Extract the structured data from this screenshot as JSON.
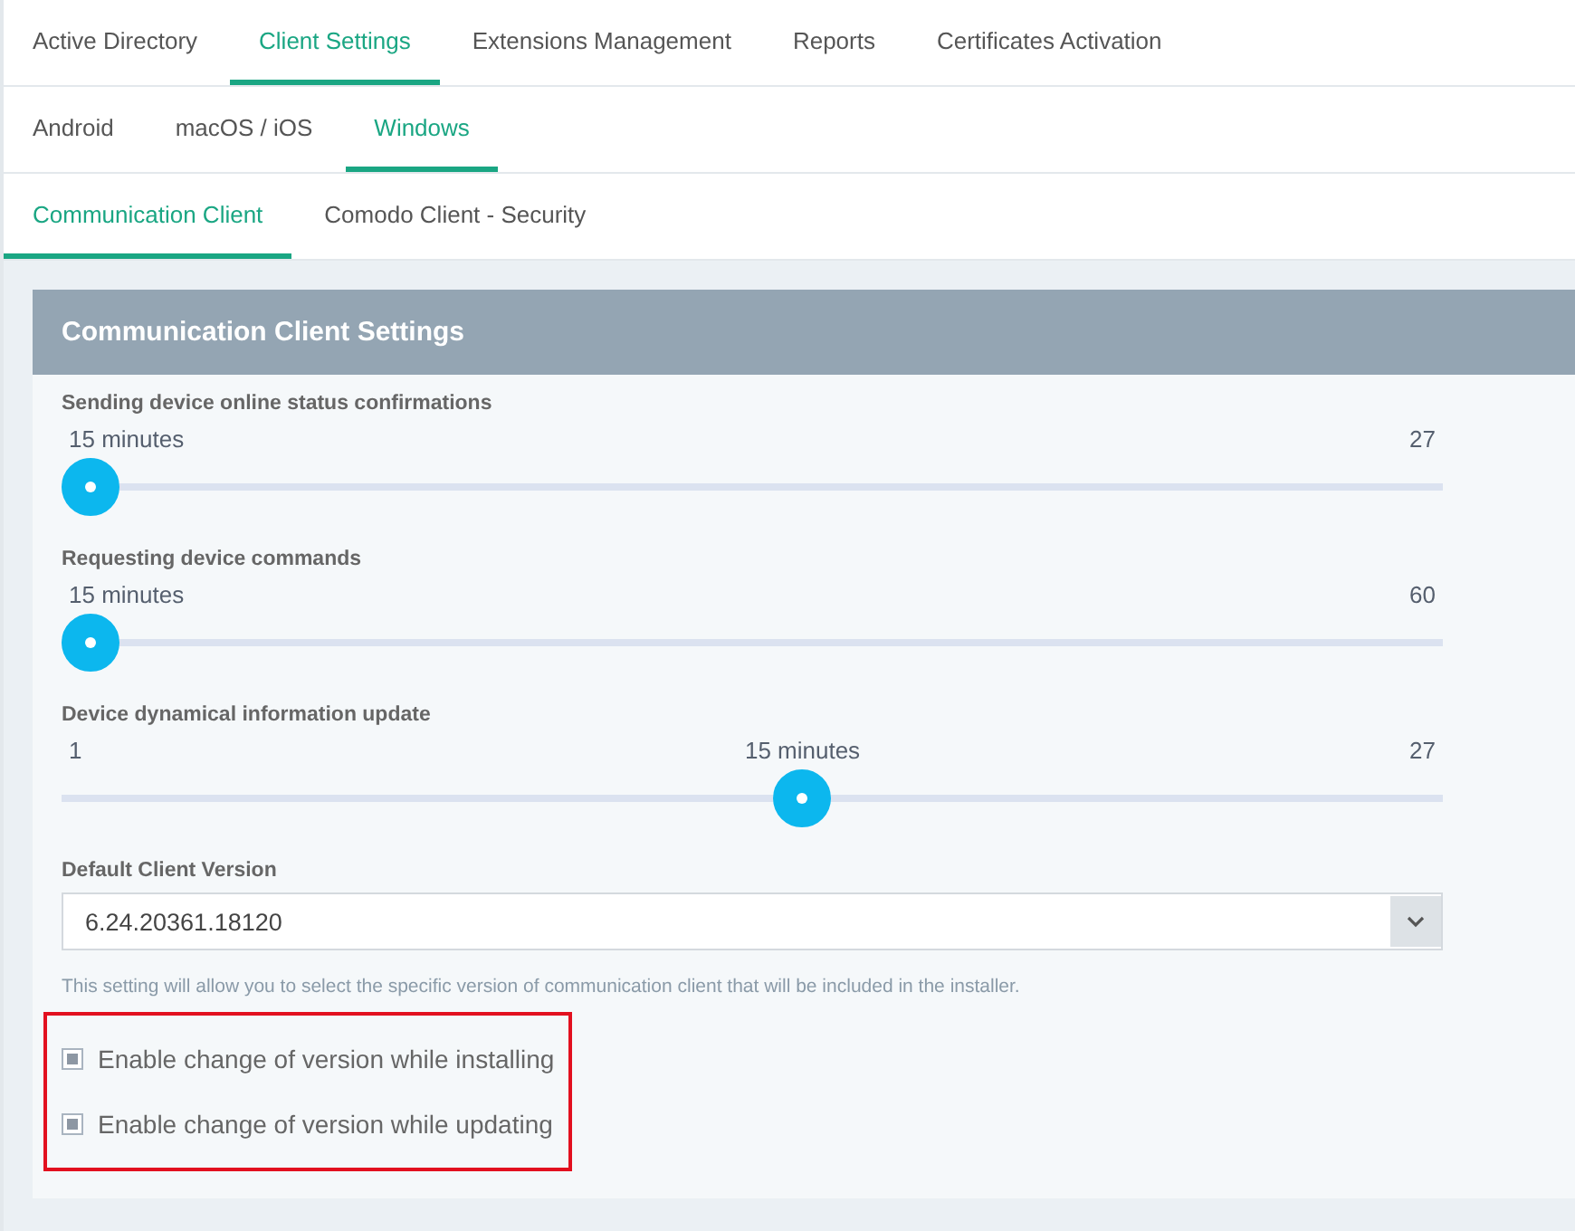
{
  "tabs": [
    {
      "label": "Active Directory",
      "selected": false
    },
    {
      "label": "Client Settings",
      "selected": true
    },
    {
      "label": "Extensions Management",
      "selected": false
    },
    {
      "label": "Reports",
      "selected": false
    },
    {
      "label": "Certificates Activation",
      "selected": false
    }
  ],
  "os_tabs": [
    {
      "label": "Android",
      "selected": false
    },
    {
      "label": "macOS / iOS",
      "selected": false
    },
    {
      "label": "Windows",
      "selected": true
    }
  ],
  "sub_tabs": [
    {
      "label": "Communication Client",
      "selected": true
    },
    {
      "label": "Comodo Client - Security",
      "selected": false
    }
  ],
  "panel": {
    "title": "Communication Client Settings",
    "sliders": [
      {
        "label": "Sending device online status confirmations",
        "value_text": "15 minutes",
        "max_text": "27",
        "level": 0
      },
      {
        "label": "Requesting device commands",
        "value_text": "15 minutes",
        "max_text": "60",
        "level": 0
      },
      {
        "label": "Device dynamical information update",
        "min_text": "1",
        "value_text": "15 minutes",
        "max_text": "27",
        "level": 0.538
      }
    ],
    "version": {
      "label": "Default Client Version",
      "value": "6.24.20361.18120",
      "hint": "This setting will allow you to select the specific version of communication client that will be included in the installer."
    },
    "checkbox_group": {
      "highlighted": true,
      "items": [
        {
          "label": "Enable change of version while installing",
          "checked": true
        },
        {
          "label": "Enable change of version while updating",
          "checked": true
        }
      ]
    }
  }
}
